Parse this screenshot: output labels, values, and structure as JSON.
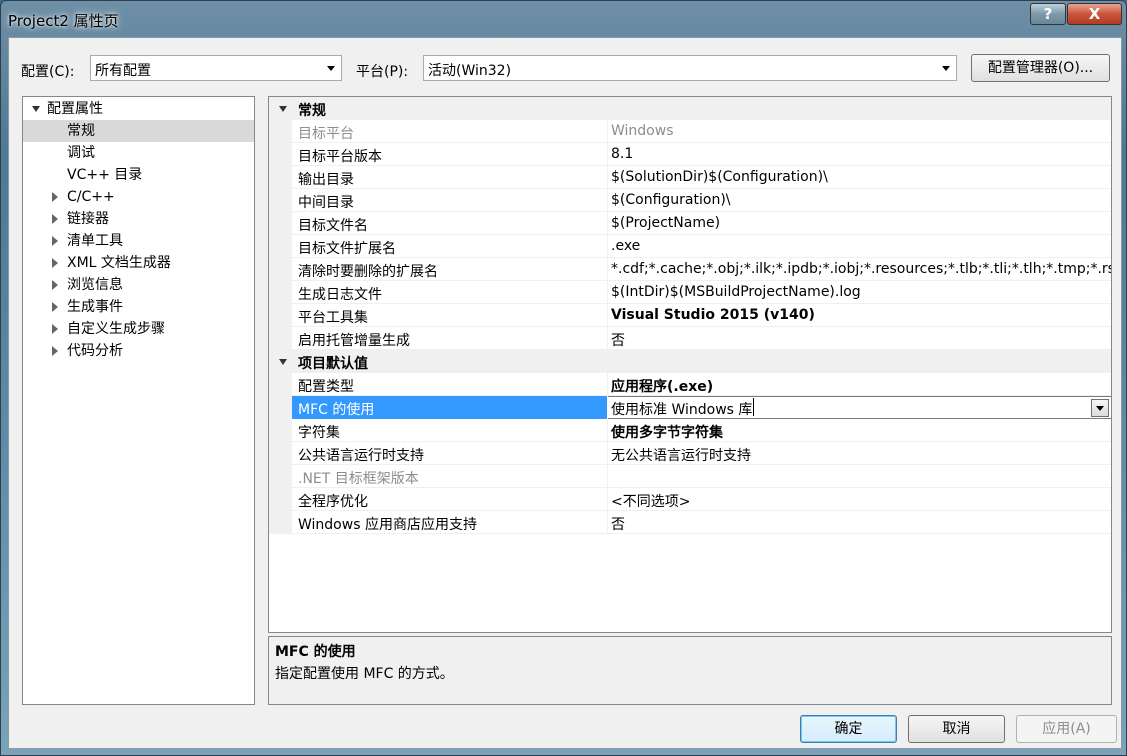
{
  "window": {
    "title": "Project2 属性页",
    "help_label": "?",
    "close_label": "X"
  },
  "toolbar": {
    "config_label": "配置(C):",
    "config_value": "所有配置",
    "platform_label": "平台(P):",
    "platform_value": "活动(Win32)",
    "config_manager_label": "配置管理器(O)..."
  },
  "tree": {
    "root": "配置属性",
    "items": [
      {
        "label": "常规",
        "selected": true,
        "expandable": false
      },
      {
        "label": "调试",
        "selected": false,
        "expandable": false
      },
      {
        "label": "VC++ 目录",
        "selected": false,
        "expandable": false
      },
      {
        "label": "C/C++",
        "selected": false,
        "expandable": true
      },
      {
        "label": "链接器",
        "selected": false,
        "expandable": true
      },
      {
        "label": "清单工具",
        "selected": false,
        "expandable": true
      },
      {
        "label": "XML 文档生成器",
        "selected": false,
        "expandable": true
      },
      {
        "label": "浏览信息",
        "selected": false,
        "expandable": true
      },
      {
        "label": "生成事件",
        "selected": false,
        "expandable": true
      },
      {
        "label": "自定义生成步骤",
        "selected": false,
        "expandable": true
      },
      {
        "label": "代码分析",
        "selected": false,
        "expandable": true
      }
    ]
  },
  "grid": {
    "cat_general": "常规",
    "general": [
      {
        "name": "目标平台",
        "value": "Windows",
        "dim": true
      },
      {
        "name": "目标平台版本",
        "value": "8.1"
      },
      {
        "name": "输出目录",
        "value": "$(SolutionDir)$(Configuration)\\"
      },
      {
        "name": "中间目录",
        "value": "$(Configuration)\\"
      },
      {
        "name": "目标文件名",
        "value": "$(ProjectName)"
      },
      {
        "name": "目标文件扩展名",
        "value": ".exe"
      },
      {
        "name": "清除时要删除的扩展名",
        "value": "*.cdf;*.cache;*.obj;*.ilk;*.ipdb;*.iobj;*.resources;*.tlb;*.tli;*.tlh;*.tmp;*.rsp"
      },
      {
        "name": "生成日志文件",
        "value": "$(IntDir)$(MSBuildProjectName).log"
      },
      {
        "name": "平台工具集",
        "value": "Visual Studio 2015 (v140)",
        "bold": true
      },
      {
        "name": "启用托管增量生成",
        "value": "否"
      }
    ],
    "cat_defaults": "项目默认值",
    "defaults": [
      {
        "name": "配置类型",
        "value": "应用程序(.exe)",
        "bold": true
      },
      {
        "name": "MFC 的使用",
        "value": "使用标准 Windows 库",
        "selected": true
      },
      {
        "name": "字符集",
        "value": "使用多字节字符集",
        "bold": true
      },
      {
        "name": "公共语言运行时支持",
        "value": "无公共语言运行时支持"
      },
      {
        "name": ".NET 目标框架版本",
        "value": "",
        "dim": true
      },
      {
        "name": "全程序优化",
        "value": "<不同选项>"
      },
      {
        "name": "Windows 应用商店应用支持",
        "value": "否"
      }
    ]
  },
  "description": {
    "title": "MFC 的使用",
    "text": "指定配置使用 MFC 的方式。"
  },
  "buttons": {
    "ok": "确定",
    "cancel": "取消",
    "apply": "应用(A)"
  }
}
